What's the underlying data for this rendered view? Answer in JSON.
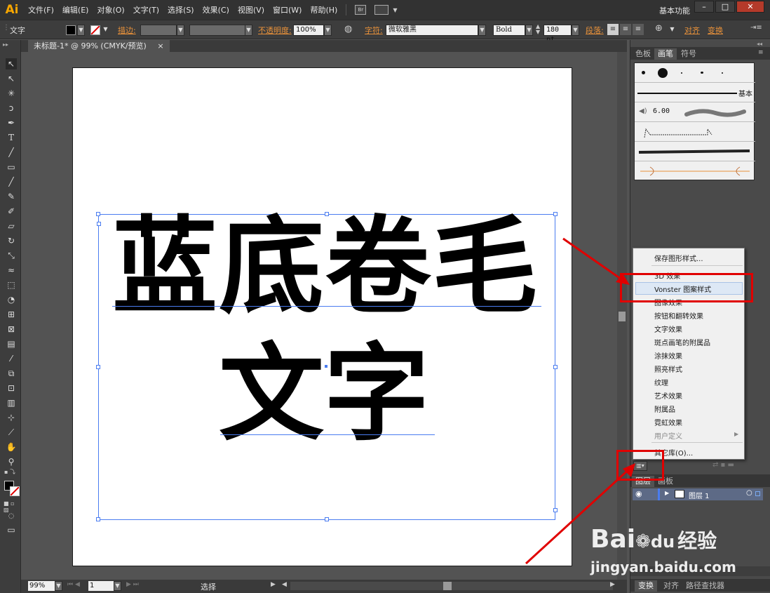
{
  "app": {
    "logo": "Ai"
  },
  "menu": [
    "文件(F)",
    "编辑(E)",
    "对象(O)",
    "文字(T)",
    "选择(S)",
    "效果(C)",
    "视图(V)",
    "窗口(W)",
    "帮助(H)"
  ],
  "menubar_extra": {
    "bridge": "Br"
  },
  "workspace": "基本功能",
  "window_buttons": {
    "minimize": "–",
    "restore": "□",
    "close": "✕"
  },
  "control": {
    "selection": "文字",
    "stroke_label": "描边:",
    "opacity_label": "不透明度:",
    "opacity_value": "100%",
    "char_label": "字符:",
    "font_family": "微软雅黑",
    "font_style": "Bold",
    "font_size": "180 pt",
    "para_label": "段落:",
    "align_label": "对齐",
    "transform_label": "变换"
  },
  "document": {
    "tab": "未标题-1* @ 99% (CMYK/预览)",
    "close": "×"
  },
  "canvas": {
    "line1": "蓝底卷毛",
    "line2": "文字"
  },
  "status": {
    "zoom": "99%",
    "page": "1",
    "text": "选择"
  },
  "panels": {
    "top_tabs": [
      "色板",
      "画笔",
      "符号"
    ],
    "brush_basic": "基本",
    "brush_size": "6.00",
    "layers_tabs": [
      "图层",
      "画板"
    ],
    "layer_name": "图层 1",
    "bottom_tabs": [
      "变换",
      "对齐",
      "路径查找器"
    ]
  },
  "style_menu": {
    "save": "保存图形样式...",
    "items": [
      "3D 效果",
      "Vonster 图案样式",
      "图像效果",
      "按钮和翻转效果",
      "文字效果",
      "斑点画笔的附属品",
      "涂抹效果",
      "照亮样式",
      "纹理",
      "艺术效果",
      "附属品",
      "霓虹效果"
    ],
    "user_defined": "用户定义",
    "other_library": "其它库(O)..."
  },
  "watermark": {
    "brand": "Bai",
    "brand2": "经验",
    "paw": "du",
    "url": "jingyan.baidu.com"
  },
  "colors": {
    "accent_orange": "#e8913a",
    "selection_blue": "#4a7cf0",
    "annotation_red": "#e00000",
    "logo": "#f7a600"
  }
}
